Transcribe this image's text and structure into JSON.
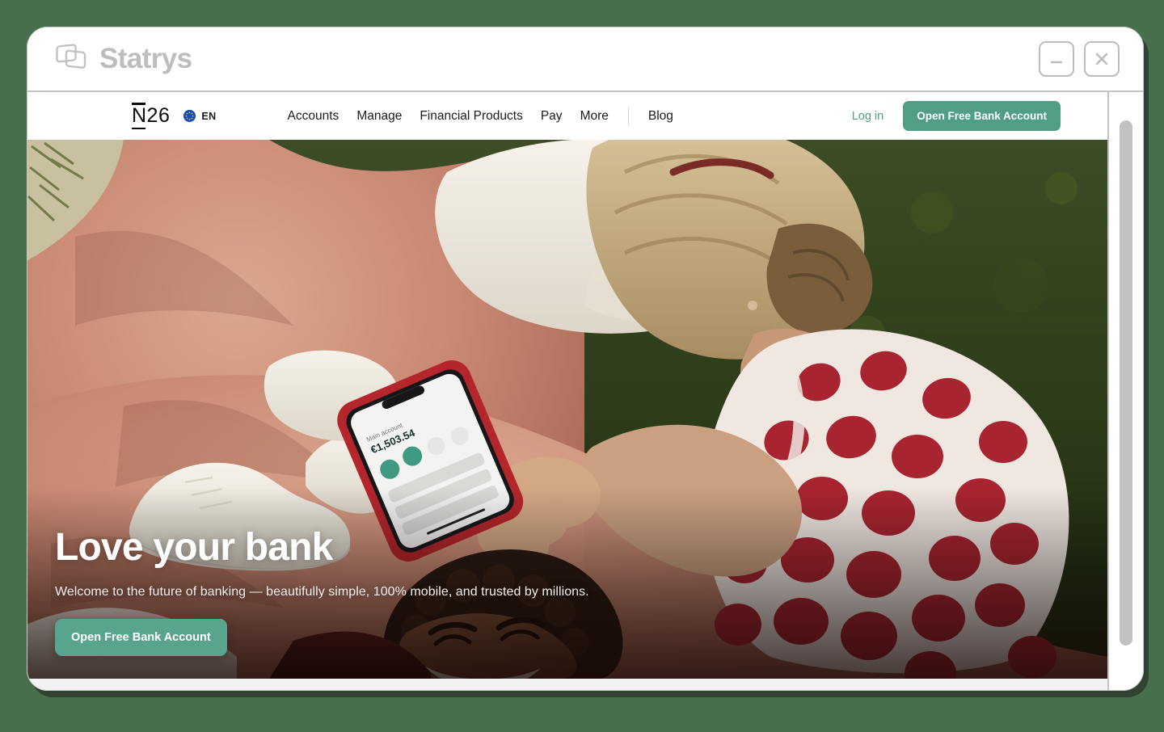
{
  "window": {
    "app_name": "Statrys",
    "logo_icon": "statrys-overlapping-cards-logo",
    "controls": [
      {
        "name": "minimize",
        "icon": "minimize-icon",
        "label": "Minimize"
      },
      {
        "name": "close",
        "icon": "close-icon",
        "label": "Close"
      }
    ]
  },
  "site": {
    "logo_text": "N26",
    "locale": {
      "flag_icon": "eu-flag-icon",
      "language": "EN"
    },
    "nav_links": [
      {
        "label": "Accounts"
      },
      {
        "label": "Manage"
      },
      {
        "label": "Financial Products"
      },
      {
        "label": "Pay"
      },
      {
        "label": "More"
      }
    ],
    "nav_links_secondary": [
      {
        "label": "Blog"
      }
    ],
    "login_label": "Log in",
    "cta_label": "Open Free Bank Account"
  },
  "hero": {
    "title": "Love your bank",
    "subtitle": "Welcome to the future of banking — beautifully simple, 100% mobile, and trusted by millions.",
    "cta_label": "Open Free Bank Account",
    "image_description": "Two people lying on a salmon-pink blanket on green grass; a person with short blonde hair in a red polka-dot dress holds a red-cased smartphone showing a banking app"
  },
  "phone_screen": {
    "balance": "€1,503.54"
  },
  "colors": {
    "desktop_background": "#476F4B",
    "accent_green": "#4F9E85",
    "hero_cta_green": "#58A48C",
    "window_chrome": "#FFFFFF",
    "brand_gray": "#BDBDBD",
    "scrollbar_thumb": "#C2C2C2",
    "grass_green": "#31401F",
    "blanket_pink": "#C98974",
    "dress_red": "#A82430"
  },
  "scrollbar": {
    "orientation": "vertical",
    "position": "near-top"
  }
}
